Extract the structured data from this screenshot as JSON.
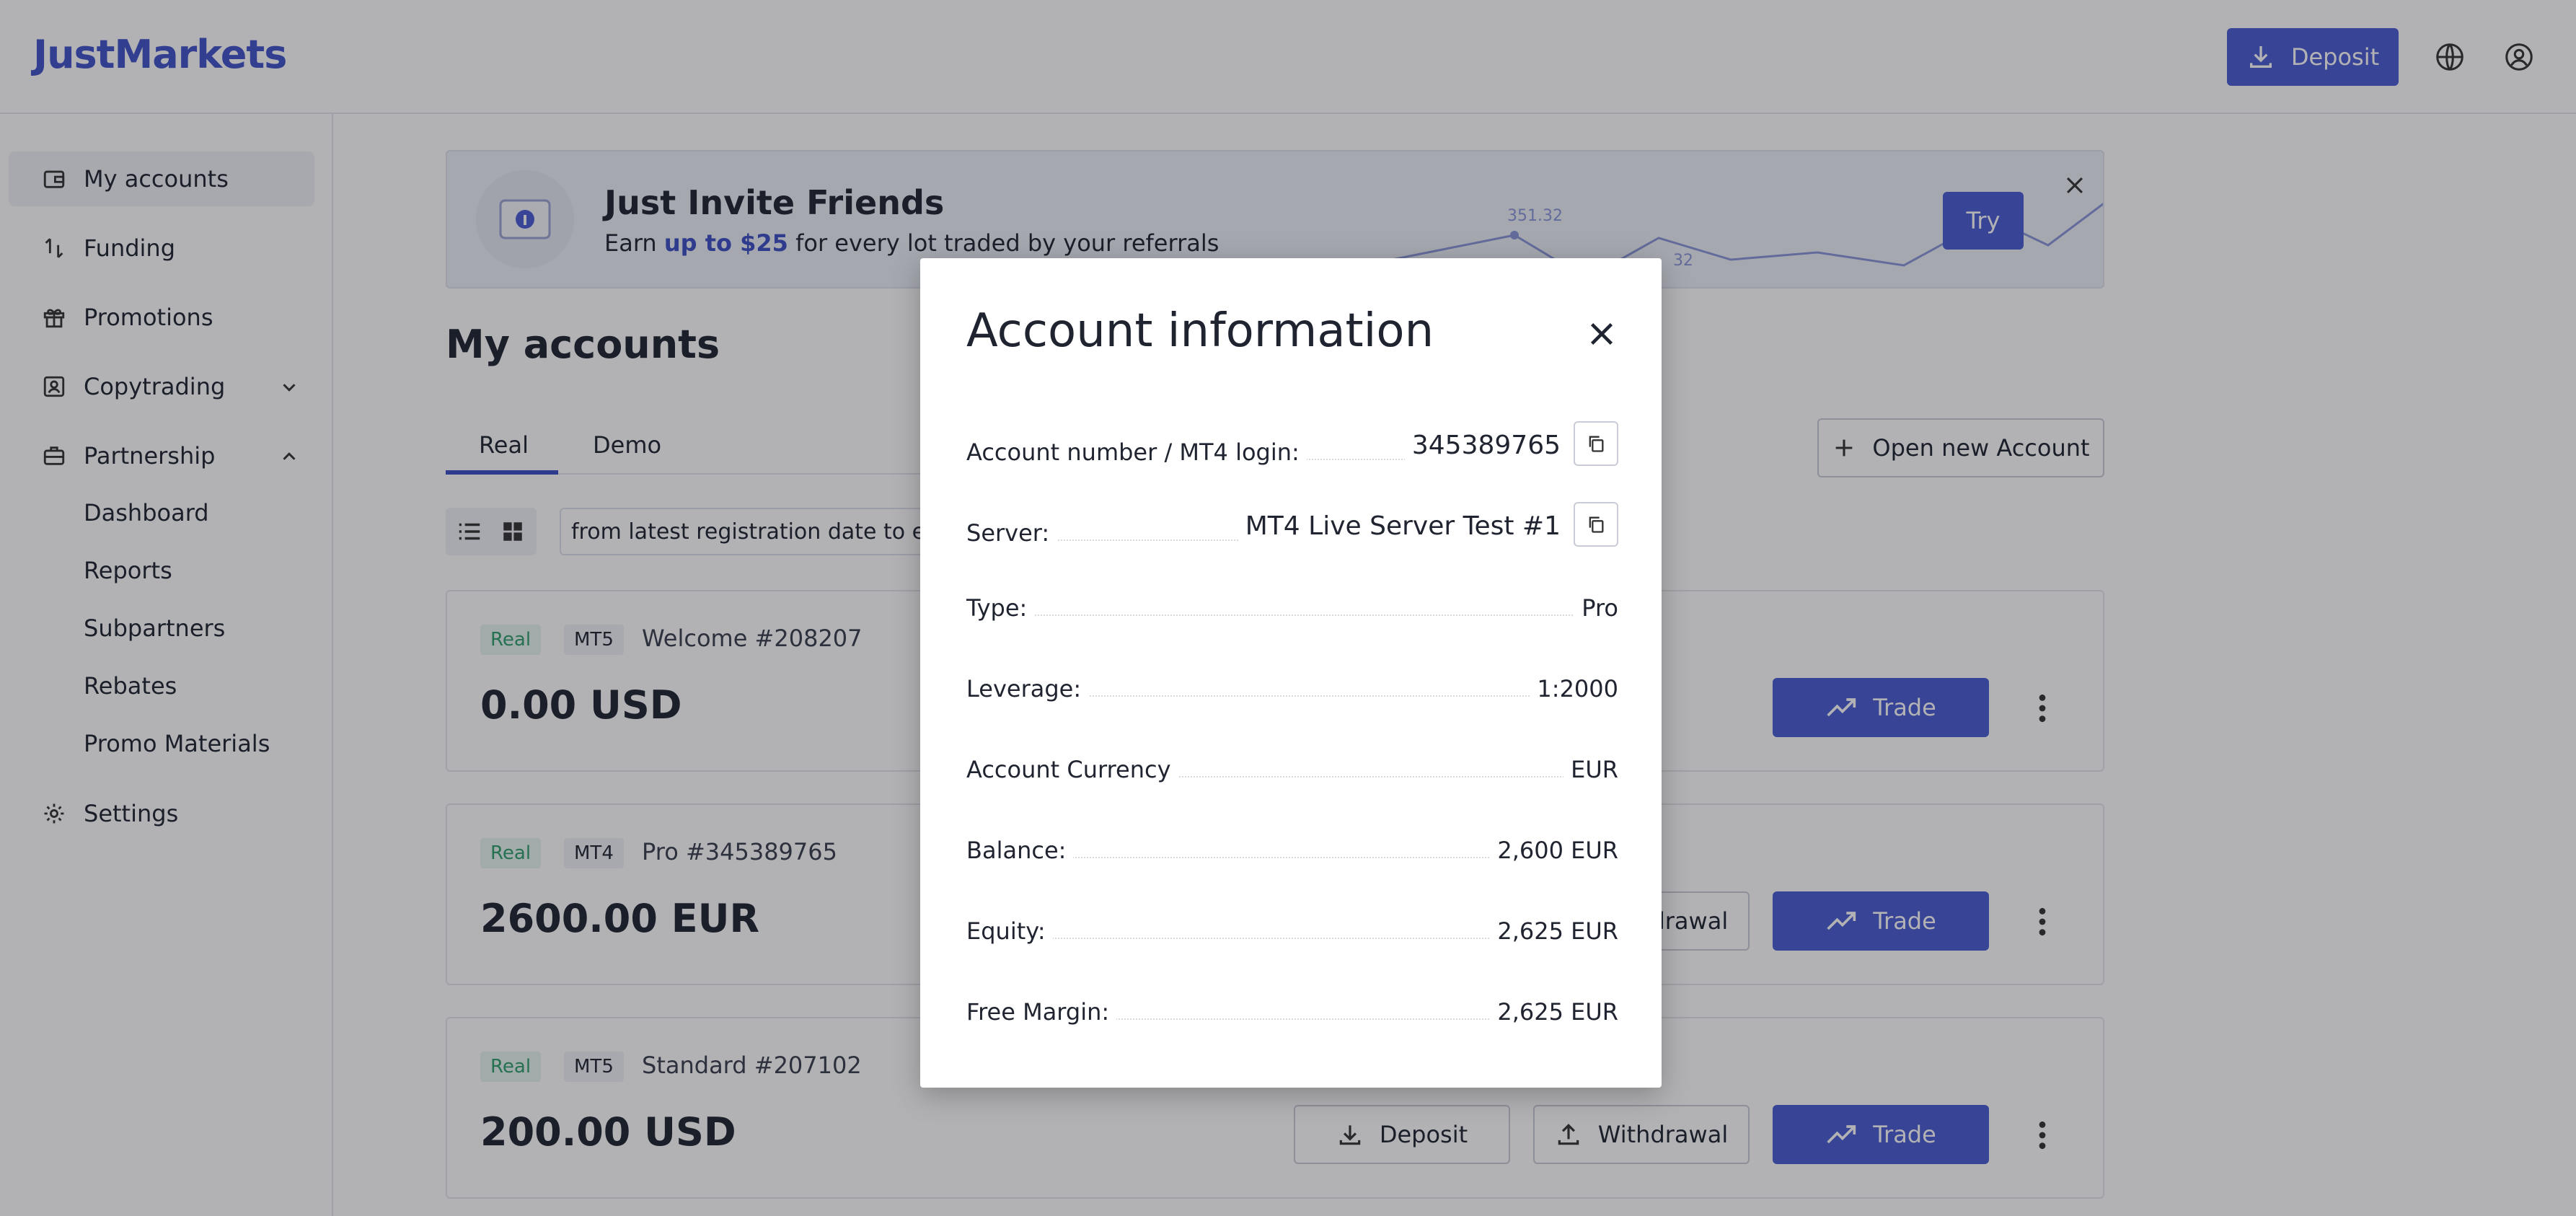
{
  "header": {
    "logo": "JustMarkets",
    "deposit_label": "Deposit"
  },
  "sidebar": {
    "items": [
      {
        "label": "My accounts"
      },
      {
        "label": "Funding"
      },
      {
        "label": "Promotions"
      },
      {
        "label": "Copytrading"
      },
      {
        "label": "Partnership"
      },
      {
        "label": "Settings"
      }
    ],
    "partnership_sub": [
      {
        "label": "Dashboard"
      },
      {
        "label": "Reports"
      },
      {
        "label": "Subpartners"
      },
      {
        "label": "Rebates"
      },
      {
        "label": "Promo Materials"
      }
    ]
  },
  "banner": {
    "title": "Just Invite Friends",
    "sub_prefix": "Earn ",
    "sub_bold": "up to $25",
    "sub_suffix": " for every lot traded by your referrals",
    "try_label": "Try",
    "chart_value_1": "351.32",
    "chart_value_2": "32"
  },
  "main": {
    "page_title": "My accounts",
    "tabs": [
      {
        "label": "Real"
      },
      {
        "label": "Demo"
      }
    ],
    "open_account_label": "Open new Account",
    "sort_text": "from latest registration date to earliest"
  },
  "accounts": [
    {
      "type_badge": "Real",
      "platform": "MT5",
      "name": "Welcome #208207",
      "balance": "0.00 USD",
      "trade_label": "Trade"
    },
    {
      "type_badge": "Real",
      "platform": "MT4",
      "name": "Pro #345389765",
      "balance": "2600.00 EUR",
      "withdrawal_label": "Withdrawal",
      "trade_label": "Trade"
    },
    {
      "type_badge": "Real",
      "platform": "MT5",
      "name": "Standard #207102",
      "balance": "200.00 USD",
      "deposit_label": "Deposit",
      "withdrawal_label": "Withdrawal",
      "trade_label": "Trade"
    }
  ],
  "modal": {
    "title": "Account information",
    "rows": [
      {
        "label": "Account number / MT4 login:",
        "value": "345389765"
      },
      {
        "label": "Server:",
        "value": "MT4 Live Server Test #1"
      },
      {
        "label": "Type:",
        "value": "Pro"
      },
      {
        "label": "Leverage:",
        "value": "1:2000"
      },
      {
        "label": "Account Currency",
        "value": "EUR"
      },
      {
        "label": "Balance:",
        "value": "2,600 EUR"
      },
      {
        "label": "Equity:",
        "value": "2,625 EUR"
      },
      {
        "label": "Free Margin:",
        "value": "2,625 EUR"
      }
    ]
  },
  "colors": {
    "brand": "#4a5cd0",
    "real_badge_text": "#2e9e6a"
  }
}
